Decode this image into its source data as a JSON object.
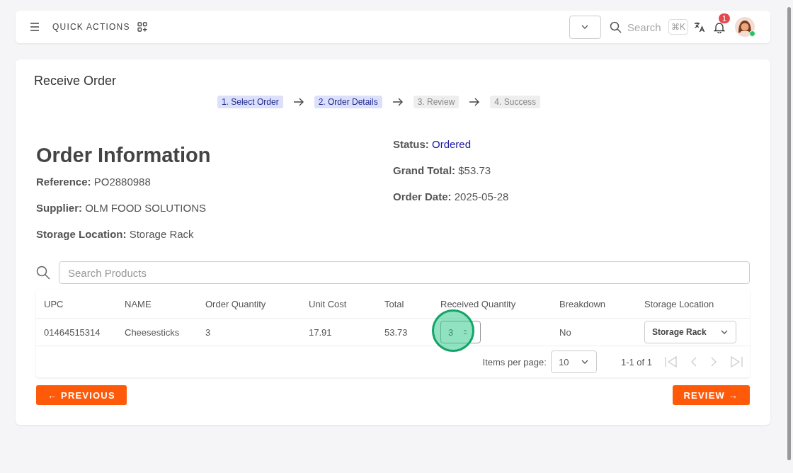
{
  "header": {
    "quick_actions": "QUICK ACTIONS",
    "search": {
      "placeholder": "Search"
    },
    "shortcut": "⌘K",
    "notifications": "1",
    "online": true
  },
  "page": {
    "title": "Receive Order",
    "steps": [
      {
        "label": "1. Select Order",
        "reached": true
      },
      {
        "label": "2. Order Details",
        "reached": true
      },
      {
        "label": "3. Review",
        "reached": false
      },
      {
        "label": "4. Success",
        "reached": false
      }
    ]
  },
  "order": {
    "heading": "Order Information",
    "left": [
      {
        "label": "Reference:",
        "value": "PO2880988"
      },
      {
        "label": "Supplier:",
        "value": "OLM FOOD SOLUTIONS"
      },
      {
        "label": "Storage Location:",
        "value": "Storage Rack"
      }
    ],
    "right": [
      {
        "label": "Status:",
        "value": "Ordered",
        "kind": "status"
      },
      {
        "label": "Grand Total:",
        "value": "$53.73",
        "kind": "plain"
      },
      {
        "label": "Order Date:",
        "value": "2025-05-28",
        "kind": "plain"
      }
    ]
  },
  "products": {
    "search": {
      "placeholder": "Search Products"
    },
    "columns": [
      "UPC",
      "NAME",
      "Order Quantity",
      "Unit Cost",
      "Total",
      "Received Quantity",
      "Breakdown",
      "Storage Location"
    ],
    "rows": [
      {
        "upc": "01464515314",
        "name": "Cheesesticks",
        "order_quantity": "3",
        "unit_cost": "17.91",
        "total": "53.73",
        "received_quantity": "3",
        "breakdown": "No",
        "storage_location": "Storage Rack",
        "clicked": true
      }
    ],
    "paginator": {
      "label": "Items per page:",
      "per_page": "10",
      "range": "1-1 of 1"
    }
  },
  "buttons": {
    "previous": "← PREVIOUS",
    "next": "REVIEW →"
  }
}
